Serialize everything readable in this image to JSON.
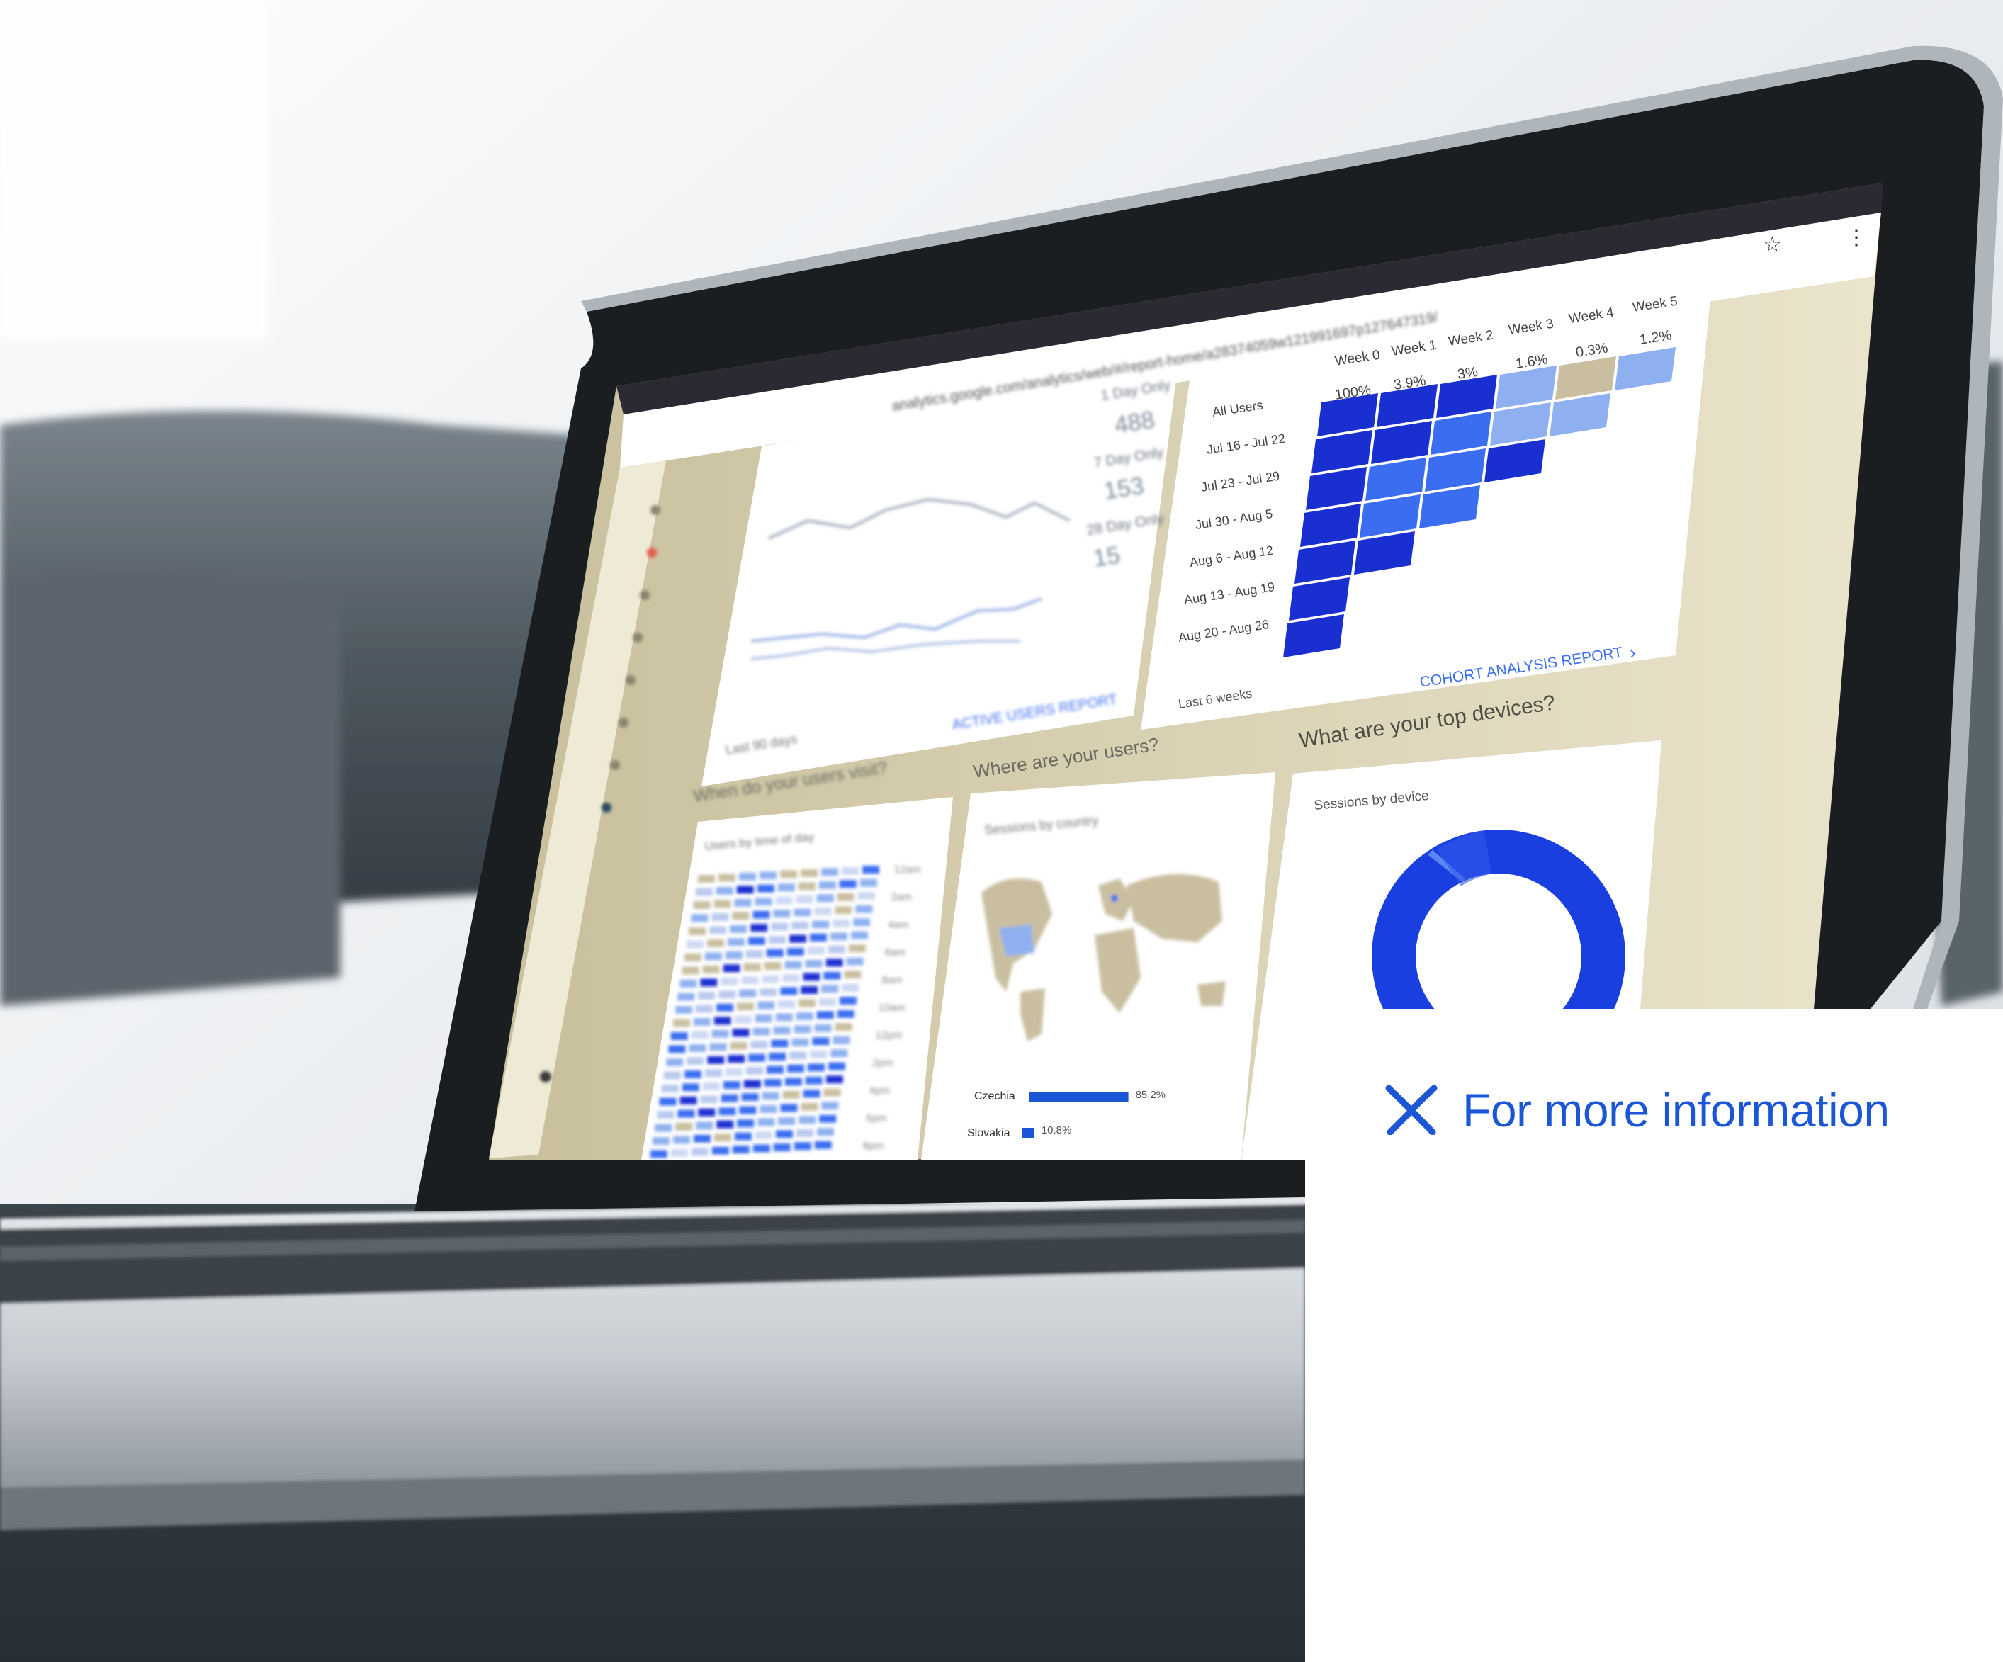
{
  "colors": {
    "accent": "#1a56d6",
    "chart_dark": "#1a2fd0",
    "chart_mid": "#3b6df0",
    "chart_light": "#8fb0f0",
    "tan": "#c9bfa0"
  },
  "cta": {
    "icon": "sparkle-icon",
    "label": "For more information"
  },
  "browser": {
    "url": "analytics.google.com/analytics/web/#/report-home/a28374059w121991697p127647319/"
  },
  "dashboard": {
    "active_users": {
      "legend": [
        "1 Day Only",
        "7 Day Only",
        "28 Day Only"
      ],
      "values": [
        "488",
        "153",
        "15"
      ],
      "footer_link": "ACTIVE USERS REPORT",
      "range": "Last 90 days"
    },
    "cohort": {
      "week_headers": [
        "Week 0",
        "Week 1",
        "Week 2",
        "Week 3",
        "Week 4",
        "Week 5"
      ],
      "percents": [
        "100%",
        "3.9%",
        "3%",
        "1.6%",
        "0.3%",
        "1.2%"
      ],
      "rows": [
        "All Users",
        "Jul 16 - Jul 22",
        "Jul 23 - Jul 29",
        "Jul 30 - Aug 5",
        "Aug 6 - Aug 12",
        "Aug 13 - Aug 19",
        "Aug 20 - Aug 26"
      ],
      "range": "Last 6 weeks",
      "footer_link": "COHORT ANALYSIS REPORT"
    },
    "time": {
      "heading": "When do your users visit?",
      "subtitle": "Users by time of day",
      "hours": [
        "12am",
        "2am",
        "4am",
        "6am",
        "8am",
        "10am",
        "12pm",
        "2pm",
        "4pm",
        "6pm",
        "8pm"
      ]
    },
    "countries": {
      "heading": "Where are your users?",
      "subtitle": "Sessions by country",
      "rows": [
        {
          "name": "Czechia",
          "pct": "85.2%",
          "value": 85.2
        },
        {
          "name": "Slovakia",
          "pct": "10.8%",
          "value": 10.8
        }
      ]
    },
    "devices": {
      "heading": "What are your top devices?",
      "subtitle": "Sessions by device"
    }
  }
}
